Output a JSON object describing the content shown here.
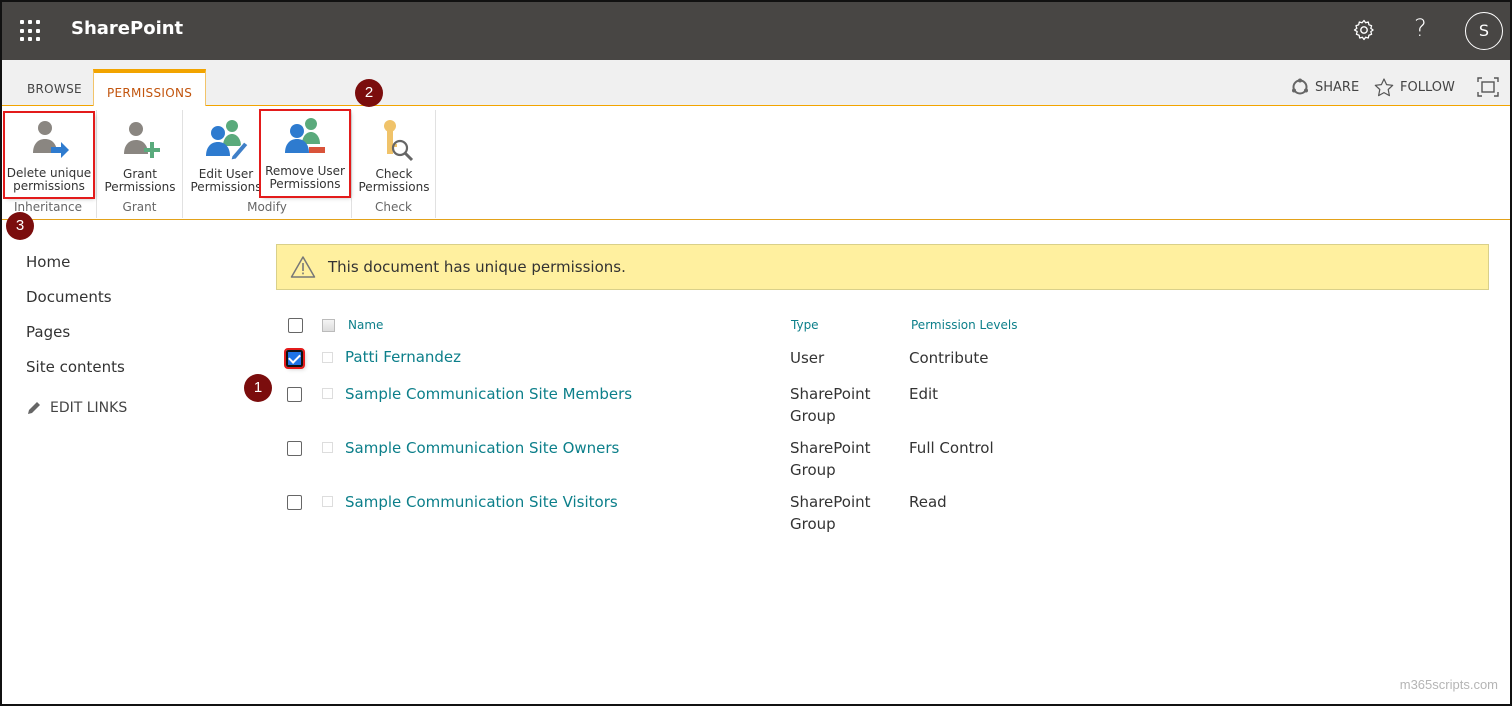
{
  "suitebar": {
    "app_title": "SharePoint",
    "avatar_initial": "S",
    "help_label": "?",
    "icons": [
      "waffle-icon",
      "gear-icon",
      "help-icon"
    ]
  },
  "ribbon": {
    "tabs": [
      {
        "label": "BROWSE",
        "active": false
      },
      {
        "label": "PERMISSIONS",
        "active": true
      }
    ],
    "actions": {
      "share": "SHARE",
      "follow": "FOLLOW"
    },
    "groups": [
      {
        "label": "Inheritance",
        "buttons": [
          {
            "label_line1": "Delete unique",
            "label_line2": "permissions",
            "icon": "user-arrow-icon",
            "highlighted": true
          }
        ]
      },
      {
        "label": "Grant",
        "buttons": [
          {
            "label_line1": "Grant",
            "label_line2": "Permissions",
            "icon": "user-add-icon",
            "highlighted": false
          }
        ]
      },
      {
        "label": "Modify",
        "buttons": [
          {
            "label_line1": "Edit User",
            "label_line2": "Permissions",
            "icon": "users-edit-icon",
            "highlighted": false
          },
          {
            "label_line1": "Remove User",
            "label_line2": "Permissions",
            "icon": "users-remove-icon",
            "highlighted": true
          }
        ]
      },
      {
        "label": "Check",
        "buttons": [
          {
            "label_line1": "Check",
            "label_line2": "Permissions",
            "icon": "key-search-icon",
            "highlighted": false
          }
        ]
      }
    ]
  },
  "markers": [
    "1",
    "2",
    "3"
  ],
  "leftnav": {
    "items": [
      "Home",
      "Documents",
      "Pages",
      "Site contents"
    ],
    "edit_links": "EDIT LINKS"
  },
  "banner": {
    "text": "This document has unique permissions.",
    "color": "#fff09f"
  },
  "table": {
    "headers": {
      "name": "Name",
      "type": "Type",
      "levels": "Permission Levels"
    },
    "rows": [
      {
        "name": "Patti Fernandez",
        "type_line1": "User",
        "type_line2": "",
        "level": "Contribute",
        "checked": true
      },
      {
        "name": "Sample Communication Site Members",
        "type_line1": "SharePoint",
        "type_line2": "Group",
        "level": "Edit",
        "checked": false
      },
      {
        "name": "Sample Communication Site Owners",
        "type_line1": "SharePoint",
        "type_line2": "Group",
        "level": "Full Control",
        "checked": false
      },
      {
        "name": "Sample Communication Site Visitors",
        "type_line1": "SharePoint",
        "type_line2": "Group",
        "level": "Read",
        "checked": false
      }
    ]
  },
  "colors": {
    "accent": "#f2a400",
    "link": "#0c7f8a",
    "suitebar": "#484644",
    "marker": "#7b0d0d",
    "highlight": "#e31b1b"
  },
  "watermark": "m365scripts.com"
}
